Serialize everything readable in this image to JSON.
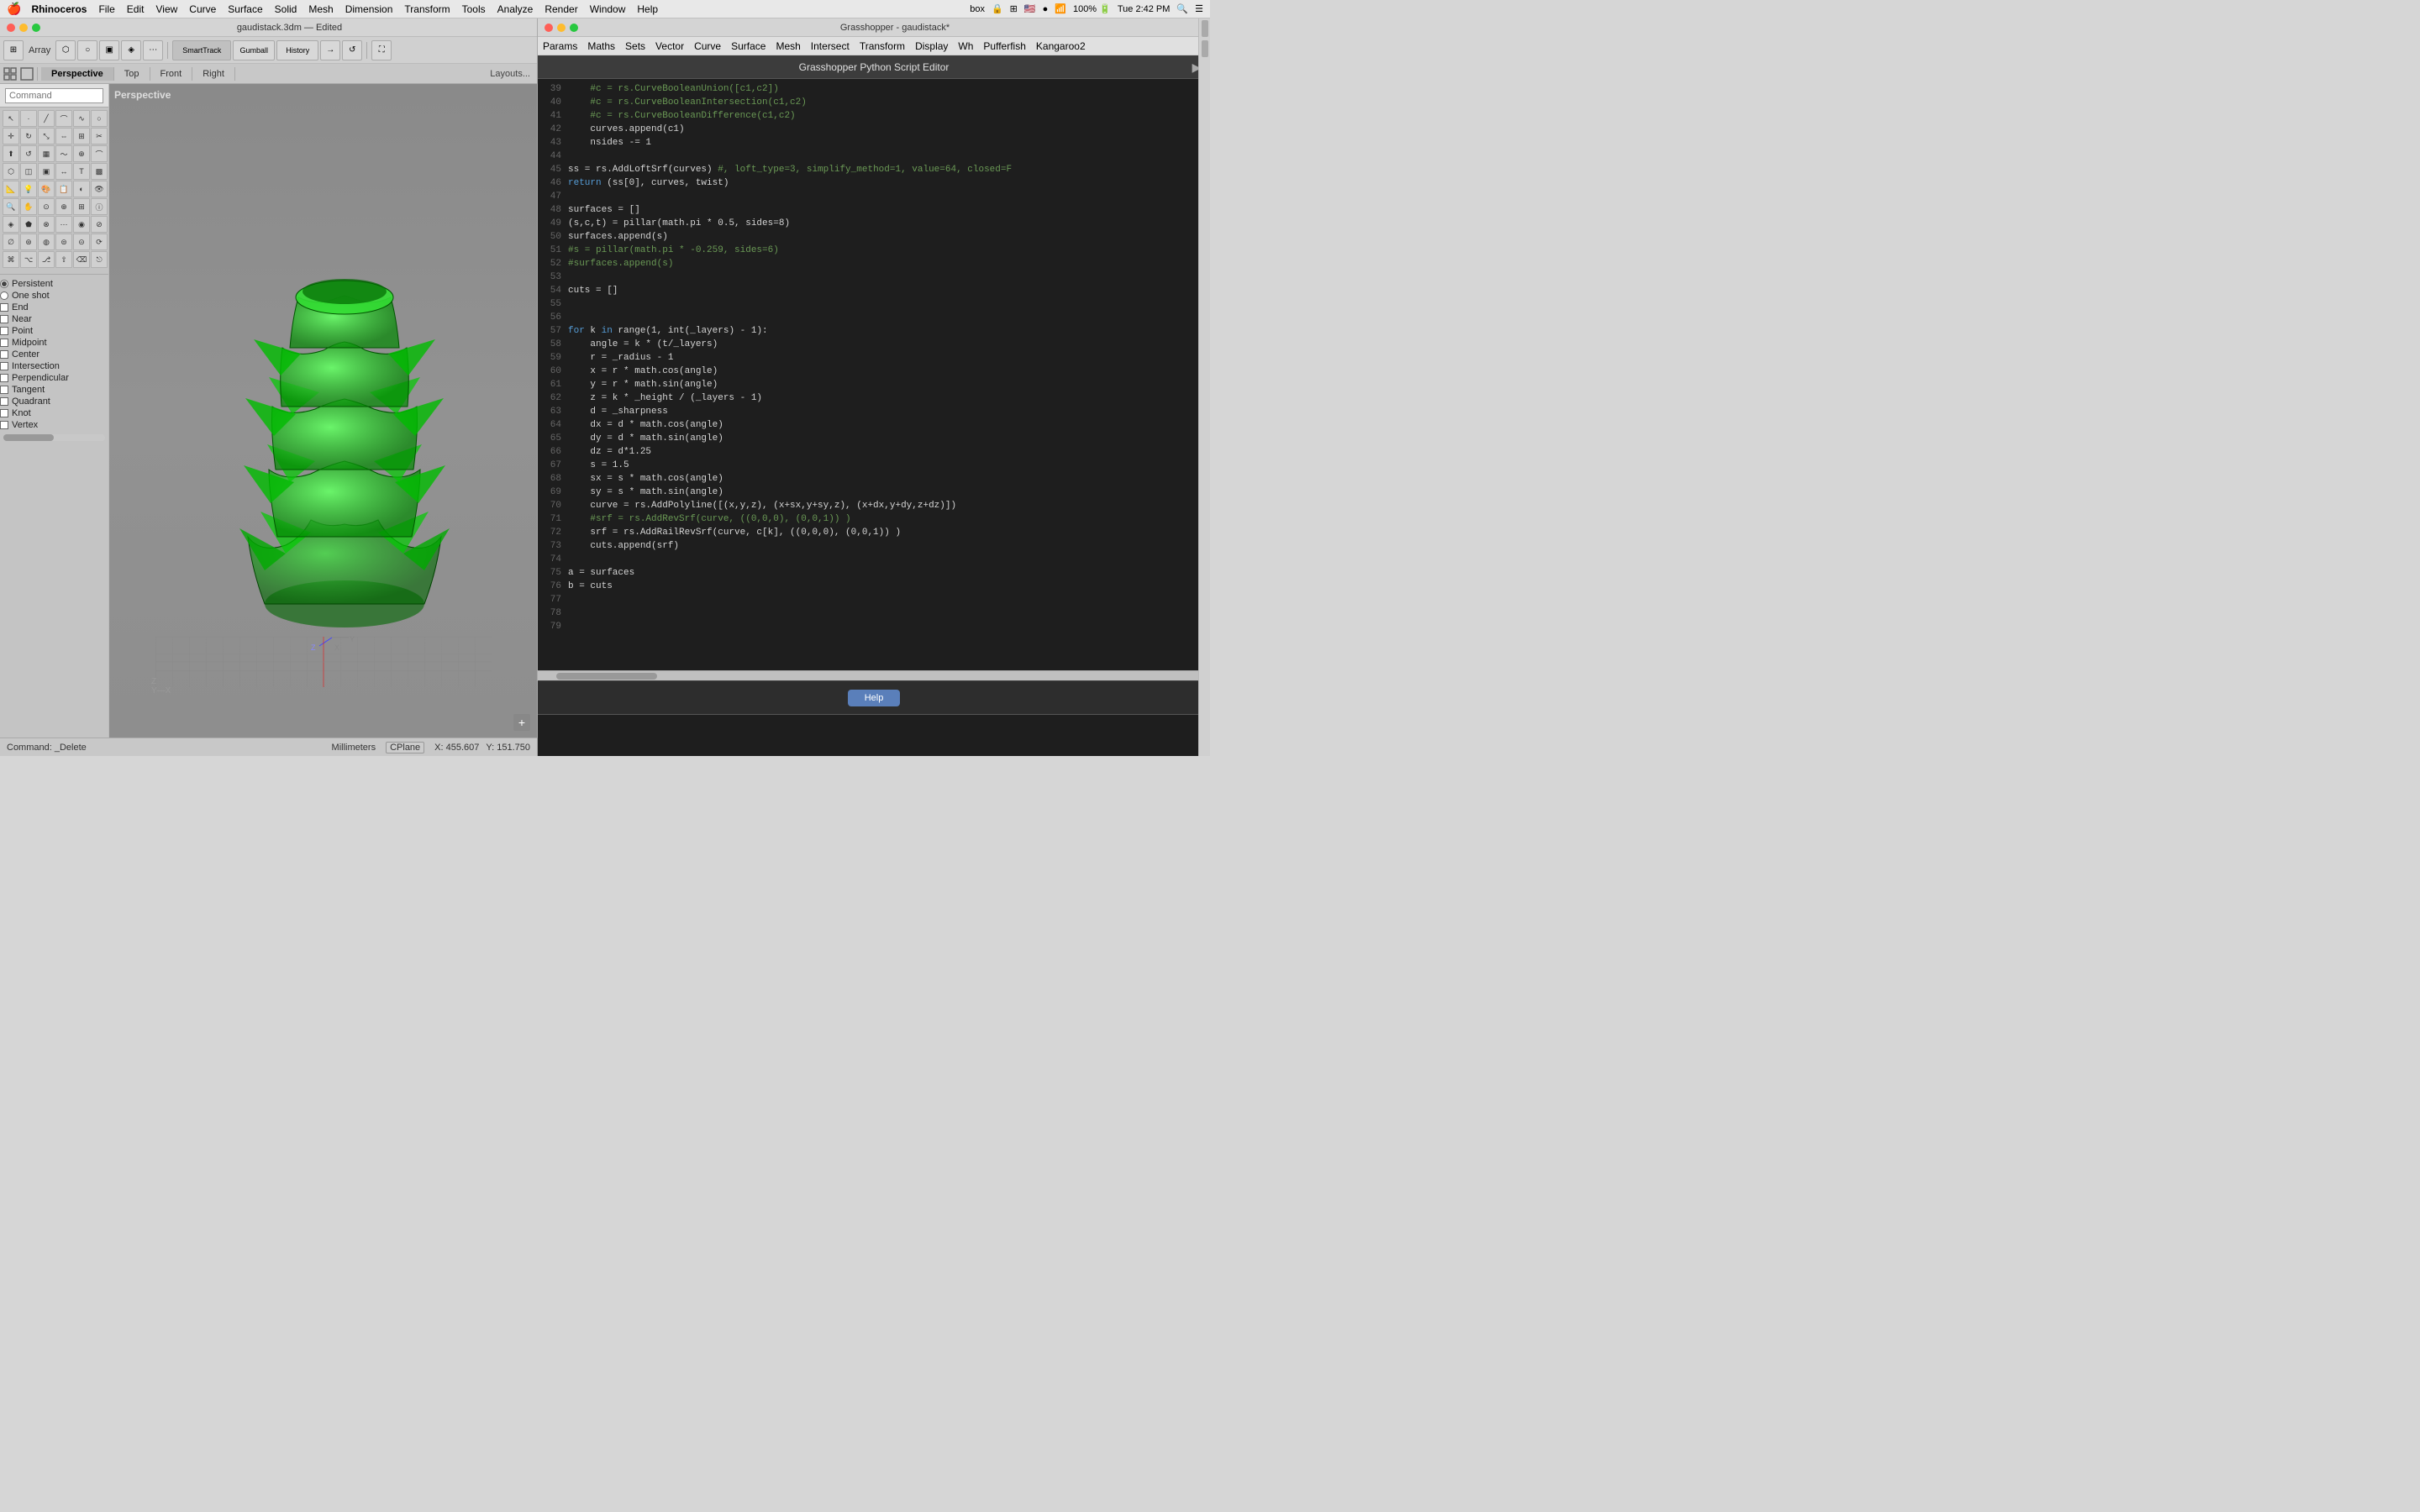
{
  "menubar": {
    "apple": "🍎",
    "items": [
      "Rhinoceros",
      "File",
      "Edit",
      "View",
      "Curve",
      "Surface",
      "Solid",
      "Mesh",
      "Dimension",
      "Transform",
      "Tools",
      "Analyze",
      "Render",
      "Window",
      "Help"
    ],
    "right": [
      "box",
      "🔒",
      "⊞",
      "🇺🇸",
      "🔵",
      "📶",
      "100%",
      "🔋",
      "Tue 2:42 PM",
      "🔍",
      "☰"
    ]
  },
  "rhino": {
    "title": "gaudistack.3dm — Edited",
    "toolbar_label": "Array",
    "tabs": {
      "smart_track": "SmartTrack",
      "gumball": "Gumball",
      "history": "History",
      "views": [
        "Perspective",
        "Top",
        "Front",
        "Right"
      ],
      "active_view": "Perspective",
      "layouts": "Layouts..."
    },
    "viewport_label": "Perspective",
    "command_placeholder": "Command",
    "command_current": "",
    "status": {
      "command": "Command: _Delete",
      "units": "Millimeters",
      "cplane": "CPlane",
      "x": "X: 455.607",
      "y": "Y: 151.750"
    },
    "snaps": {
      "title": "Persistent",
      "items": [
        {
          "label": "Persistent",
          "type": "radio",
          "checked": true
        },
        {
          "label": "One shot",
          "type": "radio",
          "checked": false
        },
        {
          "label": "End",
          "type": "checkbox",
          "checked": false
        },
        {
          "label": "Near",
          "type": "checkbox",
          "checked": false
        },
        {
          "label": "Point",
          "type": "checkbox",
          "checked": false
        },
        {
          "label": "Midpoint",
          "type": "checkbox",
          "checked": false
        },
        {
          "label": "Center",
          "type": "checkbox",
          "checked": false
        },
        {
          "label": "Intersection",
          "type": "checkbox",
          "checked": false
        },
        {
          "label": "Perpendicular",
          "type": "checkbox",
          "checked": false
        },
        {
          "label": "Tangent",
          "type": "checkbox",
          "checked": false
        },
        {
          "label": "Quadrant",
          "type": "checkbox",
          "checked": false
        },
        {
          "label": "Knot",
          "type": "checkbox",
          "checked": false
        },
        {
          "label": "Vertex",
          "type": "checkbox",
          "checked": false
        }
      ]
    }
  },
  "grasshopper": {
    "title": "Grasshopper - gaudistack*",
    "menus": [
      "Params",
      "Maths",
      "Sets",
      "Vector",
      "Curve",
      "Surface",
      "Mesh",
      "Intersect",
      "Transform",
      "Display",
      "Wh",
      "Pufferfish",
      "Kangaroo2"
    ],
    "editor": {
      "title": "Grasshopper Python Script Editor",
      "run_btn": "▶",
      "help_btn": "Help"
    }
  },
  "code": {
    "lines": [
      {
        "num": "39",
        "content": "    #c = rs.CurveBooleanUnion([c1,c2])"
      },
      {
        "num": "40",
        "content": "    #c = rs.CurveBooleanIntersection(c1,c2)"
      },
      {
        "num": "41",
        "content": "    #c = rs.CurveBooleanDifference(c1,c2)"
      },
      {
        "num": "42",
        "content": "    curves.append(c1)"
      },
      {
        "num": "43",
        "content": "    nsides -= 1"
      },
      {
        "num": "44",
        "content": ""
      },
      {
        "num": "45",
        "content": "ss = rs.AddLoftSrf(curves) #, loft_type=3, simplify_method=1, value=64, closed=F"
      },
      {
        "num": "46",
        "content": "return (ss[0], curves, twist)"
      },
      {
        "num": "47",
        "content": ""
      },
      {
        "num": "48",
        "content": "surfaces = []"
      },
      {
        "num": "49",
        "content": "(s,c,t) = pillar(math.pi * 0.5, sides=8)"
      },
      {
        "num": "50",
        "content": "surfaces.append(s)"
      },
      {
        "num": "51",
        "content": "#s = pillar(math.pi * -0.259, sides=6)"
      },
      {
        "num": "52",
        "content": "#surfaces.append(s)"
      },
      {
        "num": "53",
        "content": ""
      },
      {
        "num": "54",
        "content": "cuts = []"
      },
      {
        "num": "55",
        "content": ""
      },
      {
        "num": "56",
        "content": ""
      },
      {
        "num": "57",
        "content": "for k in range(1, int(_layers) - 1):"
      },
      {
        "num": "58",
        "content": "    angle = k * (t/_layers)"
      },
      {
        "num": "59",
        "content": "    r = _radius - 1"
      },
      {
        "num": "60",
        "content": "    x = r * math.cos(angle)"
      },
      {
        "num": "61",
        "content": "    y = r * math.sin(angle)"
      },
      {
        "num": "62",
        "content": "    z = k * _height / (_layers - 1)"
      },
      {
        "num": "63",
        "content": "    d = _sharpness"
      },
      {
        "num": "64",
        "content": "    dx = d * math.cos(angle)"
      },
      {
        "num": "65",
        "content": "    dy = d * math.sin(angle)"
      },
      {
        "num": "66",
        "content": "    dz = d*1.25"
      },
      {
        "num": "67",
        "content": "    s = 1.5"
      },
      {
        "num": "68",
        "content": "    sx = s * math.cos(angle)"
      },
      {
        "num": "69",
        "content": "    sy = s * math.sin(angle)"
      },
      {
        "num": "70",
        "content": "    curve = rs.AddPolyline([(x,y,z), (x+sx,y+sy,z), (x+dx,y+dy,z+dz)])"
      },
      {
        "num": "71",
        "content": "    #srf = rs.AddRevSrf(curve, ((0,0,0), (0,0,1)) )"
      },
      {
        "num": "72",
        "content": "    srf = rs.AddRailRevSrf(curve, c[k], ((0,0,0), (0,0,1)) )"
      },
      {
        "num": "73",
        "content": "    cuts.append(srf)"
      },
      {
        "num": "74",
        "content": ""
      },
      {
        "num": "75",
        "content": "a = surfaces"
      },
      {
        "num": "76",
        "content": "b = cuts"
      },
      {
        "num": "77",
        "content": ""
      },
      {
        "num": "78",
        "content": ""
      },
      {
        "num": "79",
        "content": ""
      }
    ]
  }
}
